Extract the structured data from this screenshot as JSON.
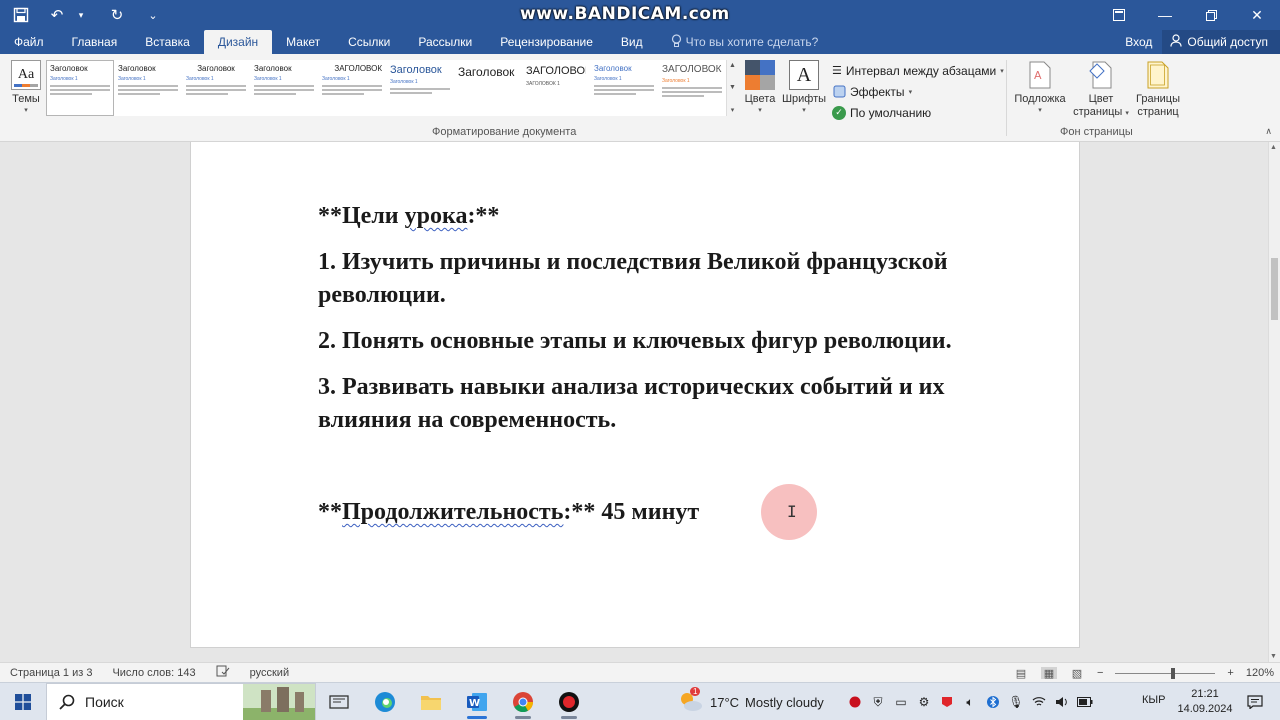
{
  "watermark": "www.BANDICAM.com",
  "tabs": [
    "Файл",
    "Главная",
    "Вставка",
    "Дизайн",
    "Макет",
    "Ссылки",
    "Рассылки",
    "Рецензирование",
    "Вид"
  ],
  "tell_me": "Что вы хотите сделать?",
  "login": "Вход",
  "share": "Общий доступ",
  "ribbon": {
    "themes": "Темы",
    "gallery": [
      {
        "title": "Заголовок",
        "sub": "Заголовок 1"
      },
      {
        "title": "Заголовок",
        "sub": "Заголовок 1"
      },
      {
        "title": "Заголовок",
        "sub": "Заголовок 1"
      },
      {
        "title": "Заголовок",
        "sub": "Заголовок 1"
      },
      {
        "title": "ЗАГОЛОВОК",
        "sub": "Заголовок 1"
      },
      {
        "title": "Заголовок",
        "sub": "Заголовок 1"
      },
      {
        "title": "Заголовок",
        "sub": ""
      },
      {
        "title": "ЗАГОЛОВОК",
        "sub": "ЗАГОЛОВОК 1"
      },
      {
        "title": "Заголовок",
        "sub": "Заголовок 1"
      },
      {
        "title": "ЗАГОЛОВОК",
        "sub": "Заголовок 1"
      }
    ],
    "colors": "Цвета",
    "fonts": "Шрифты",
    "paragraph_spacing": "Интервал между абзацами",
    "effects": "Эффекты",
    "default": "По умолчанию",
    "group_doc": "Форматирование документа",
    "watermark_btn": "Подложка",
    "page_color_1": "Цвет",
    "page_color_2": "страницы",
    "page_borders_1": "Границы",
    "page_borders_2": "страниц",
    "group_bg": "Фон страницы"
  },
  "document": {
    "goals_stars1": "**",
    "goals_word1": "Цели",
    "goals_word2": "урока",
    "goals_tail": ":**",
    "item1": "1. Изучить причины и последствия Великой французской революции.",
    "item2": "2. Понять основные этапы и ключевых фигур революции.",
    "item3": "3. Развивать навыки анализа исторических событий и их влияния на современность.",
    "dur_stars1": "**",
    "dur_word": "Продолжительность",
    "dur_tail": ":**",
    "dur_value": " 45 минут"
  },
  "status": {
    "page": "Страница 1 из 3",
    "words": "Число слов: 143",
    "lang": "русский",
    "zoom": "120%"
  },
  "taskbar": {
    "search": "Поиск",
    "temp": "17°C",
    "weather": "Mostly cloudy",
    "badge": "1",
    "lang": "КЫР",
    "time": "21:21",
    "date": "14.09.2024"
  },
  "colors": {
    "titlebar": "#2b579a",
    "ribbon": "#f3f3f3",
    "accent_orange": "#ed7d31",
    "accent_blue": "#4472c4"
  }
}
